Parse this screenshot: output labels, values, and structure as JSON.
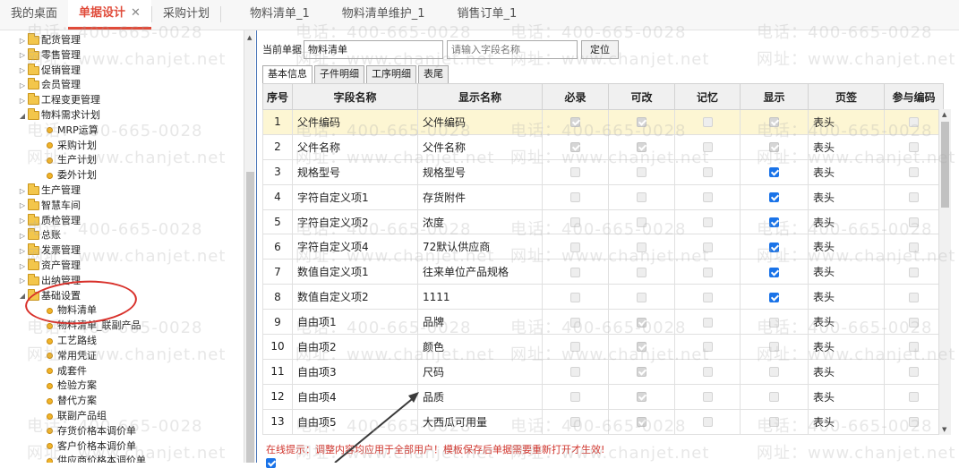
{
  "tabs": [
    {
      "label": "我的桌面"
    },
    {
      "label": "单据设计",
      "active": true
    },
    {
      "label": "采购计划"
    },
    {
      "label": "物料清单_1"
    },
    {
      "label": "物料清单维护_1"
    },
    {
      "label": "销售订单_1"
    }
  ],
  "tab_close_symbol": "✕",
  "tree": [
    {
      "label": "配货管理",
      "type": "folder",
      "expanded": false
    },
    {
      "label": "零售管理",
      "type": "folder",
      "expanded": false
    },
    {
      "label": "促销管理",
      "type": "folder",
      "expanded": false
    },
    {
      "label": "会员管理",
      "type": "folder",
      "expanded": false
    },
    {
      "label": "工程变更管理",
      "type": "folder",
      "expanded": false
    },
    {
      "label": "物料需求计划",
      "type": "folder",
      "expanded": true
    },
    {
      "label": "MRP运算",
      "type": "leaf"
    },
    {
      "label": "采购计划",
      "type": "leaf"
    },
    {
      "label": "生产计划",
      "type": "leaf"
    },
    {
      "label": "委外计划",
      "type": "leaf"
    },
    {
      "label": "生产管理",
      "type": "folder",
      "expanded": false
    },
    {
      "label": "智慧车间",
      "type": "folder",
      "expanded": false
    },
    {
      "label": "质检管理",
      "type": "folder",
      "expanded": false
    },
    {
      "label": "总账",
      "type": "folder",
      "expanded": false
    },
    {
      "label": "发票管理",
      "type": "folder",
      "expanded": false
    },
    {
      "label": "资产管理",
      "type": "folder",
      "expanded": false
    },
    {
      "label": "出纳管理",
      "type": "folder",
      "expanded": false
    },
    {
      "label": "基础设置",
      "type": "folder",
      "expanded": true
    },
    {
      "label": "物料清单",
      "type": "leaf",
      "selected": true
    },
    {
      "label": "物料清单_联副产品",
      "type": "leaf"
    },
    {
      "label": "工艺路线",
      "type": "leaf"
    },
    {
      "label": "常用凭证",
      "type": "leaf"
    },
    {
      "label": "成套件",
      "type": "leaf"
    },
    {
      "label": "检验方案",
      "type": "leaf"
    },
    {
      "label": "替代方案",
      "type": "leaf"
    },
    {
      "label": "联副产品组",
      "type": "leaf"
    },
    {
      "label": "存货价格本调价单",
      "type": "leaf"
    },
    {
      "label": "客户价格本调价单",
      "type": "leaf"
    },
    {
      "label": "供应商价格本调价单",
      "type": "leaf"
    }
  ],
  "query": {
    "current_doc_label": "当前单据",
    "current_doc_value": "物料清单",
    "search_placeholder": "请输入字段名称",
    "locate_label": "定位"
  },
  "subtabs": [
    {
      "label": "基本信息",
      "active": true
    },
    {
      "label": "子件明细"
    },
    {
      "label": "工序明细"
    },
    {
      "label": "表尾"
    }
  ],
  "table": {
    "headers": [
      "序号",
      "字段名称",
      "显示名称",
      "必录",
      "可改",
      "记忆",
      "显示",
      "页签",
      "参与编码"
    ],
    "rows": [
      {
        "no": "1",
        "field": "父件编码",
        "display": "父件编码",
        "required": "gon",
        "editable": "gon",
        "memory": "dis",
        "show": "gon",
        "page": "表头",
        "code": "dis",
        "selected": true
      },
      {
        "no": "2",
        "field": "父件名称",
        "display": "父件名称",
        "required": "gon",
        "editable": "gon",
        "memory": "dis",
        "show": "gon",
        "page": "表头",
        "code": "dis"
      },
      {
        "no": "3",
        "field": "规格型号",
        "display": "规格型号",
        "required": "dis",
        "editable": "dis",
        "memory": "dis",
        "show": "on",
        "page": "表头",
        "code": "dis"
      },
      {
        "no": "4",
        "field": "字符自定义项1",
        "display": "存货附件",
        "required": "dis",
        "editable": "dis",
        "memory": "dis",
        "show": "on",
        "page": "表头",
        "code": "dis"
      },
      {
        "no": "5",
        "field": "字符自定义项2",
        "display": "浓度",
        "required": "dis",
        "editable": "dis",
        "memory": "dis",
        "show": "on",
        "page": "表头",
        "code": "dis"
      },
      {
        "no": "6",
        "field": "字符自定义项4",
        "display": "72默认供应商",
        "required": "dis",
        "editable": "dis",
        "memory": "dis",
        "show": "on",
        "page": "表头",
        "code": "dis"
      },
      {
        "no": "7",
        "field": "数值自定义项1",
        "display": "往来单位产品规格",
        "required": "dis",
        "editable": "dis",
        "memory": "dis",
        "show": "on",
        "page": "表头",
        "code": "dis"
      },
      {
        "no": "8",
        "field": "数值自定义项2",
        "display": "1111",
        "required": "dis",
        "editable": "dis",
        "memory": "dis",
        "show": "on",
        "page": "表头",
        "code": "dis"
      },
      {
        "no": "9",
        "field": "自由项1",
        "display": "品牌",
        "required": "dis",
        "editable": "gon",
        "memory": "dis",
        "show": "dis",
        "page": "表头",
        "code": "dis"
      },
      {
        "no": "10",
        "field": "自由项2",
        "display": "颜色",
        "required": "dis",
        "editable": "gon",
        "memory": "dis",
        "show": "dis",
        "page": "表头",
        "code": "dis"
      },
      {
        "no": "11",
        "field": "自由项3",
        "display": "尺码",
        "required": "dis",
        "editable": "gon",
        "memory": "dis",
        "show": "dis",
        "page": "表头",
        "code": "dis"
      },
      {
        "no": "12",
        "field": "自由项4",
        "display": "品质",
        "required": "dis",
        "editable": "gon",
        "memory": "dis",
        "show": "dis",
        "page": "表头",
        "code": "dis"
      },
      {
        "no": "13",
        "field": "自由项5",
        "display": "大西瓜可用量",
        "required": "dis",
        "editable": "gon",
        "memory": "dis",
        "show": "dis",
        "page": "表头",
        "code": "dis"
      }
    ]
  },
  "hint": {
    "label": "在线提示：",
    "text": "调整内容均应用于全部用户！模板保存后单据需要重新打开才生效!"
  },
  "colors": {
    "accent": "#e04b3a",
    "check": "#1a73e8",
    "annotation": "#d8302a"
  },
  "watermarks": {
    "phone": "电话：400-665-0028",
    "site": "网址：www.chanjet.net"
  }
}
